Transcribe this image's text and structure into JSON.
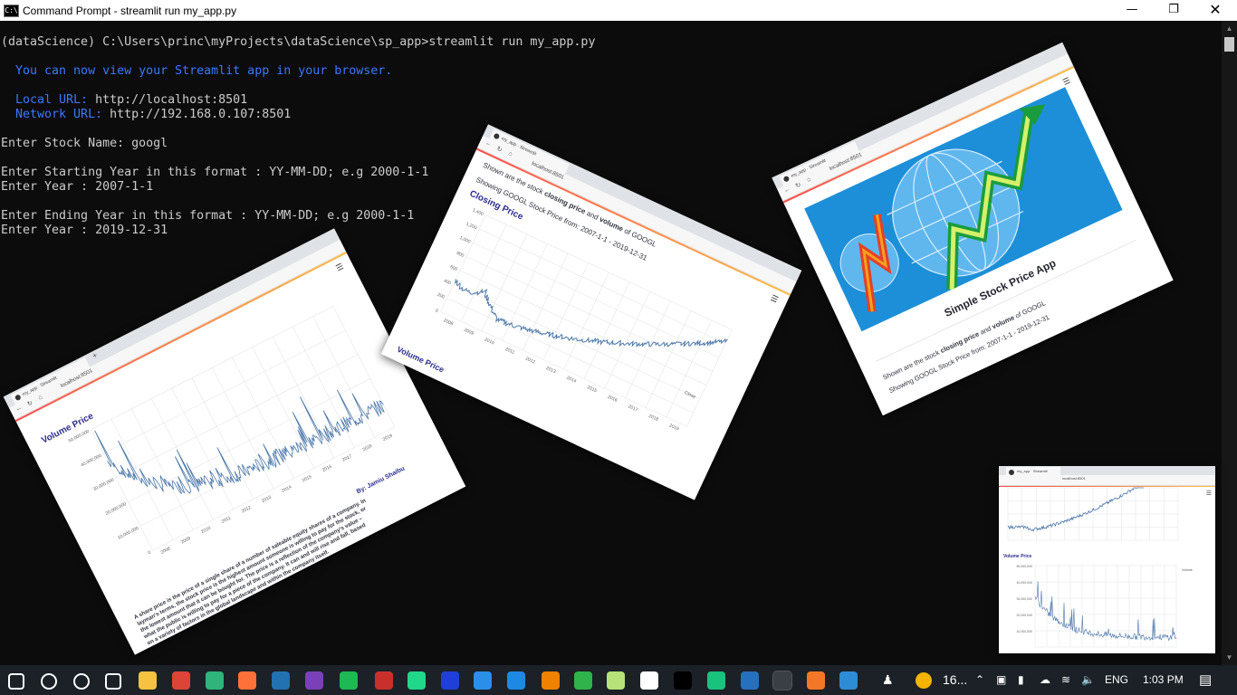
{
  "window": {
    "title": "Command Prompt - streamlit  run my_app.py"
  },
  "console": {
    "lines": [
      {
        "text": "(dataScience) C:\\Users\\princ\\myProjects\\dataScience\\sp_app>streamlit run my_app.py",
        "top": 16
      },
      {
        "text": "  You can now view your Streamlit app in your browser.",
        "top": 48,
        "blue": true
      },
      {
        "label": "  Local URL: ",
        "value": "http://localhost:8501",
        "top": 80
      },
      {
        "label": "  Network URL: ",
        "value": "http://192.168.0.107:8501",
        "top": 96
      },
      {
        "text": "Enter Stock Name: googl",
        "top": 128
      },
      {
        "text": "Enter Starting Year in this format : YY-MM-DD; e.g 2000-1-1",
        "top": 160
      },
      {
        "text": "Enter Year : 2007-1-1",
        "top": 176
      },
      {
        "text": "Enter Ending Year in this format : YY-MM-DD; e.g 2000-1-1",
        "top": 208
      },
      {
        "text": "Enter Year : 2019-12-31",
        "top": 224
      }
    ]
  },
  "shots": {
    "volume": {
      "tab": "my_app · Streamlit",
      "url": "localhost:8501",
      "heading": "Volume Price",
      "legend": "Volume",
      "yticks": [
        "50,000,000",
        "40,000,000",
        "30,000,000",
        "20,000,000",
        "10,000,000",
        "0"
      ],
      "xticks": [
        "2008",
        "2009",
        "2010",
        "2011",
        "2012",
        "2013",
        "2014",
        "2015",
        "2016",
        "2017",
        "2018",
        "2019"
      ],
      "author": "By: Jamiu Shaibu",
      "description_lines": [
        "A share price is the price of a single share of a number of saleable equity shares of a company. In",
        "layman's terms, the stock price is the highest amount someone is willing to pay for the stock, or",
        "the lowest amount that it can be bought for. The price is a reflection of the company's value –",
        "what the public is willing to pay for a piece of the company. It can and will rise and fall, based",
        "on a variety of factors in the global landscape and within the company itself."
      ]
    },
    "closing": {
      "tab": "my_app · Streamlit",
      "url": "localhost:8501",
      "intro_prefix": "Shown are the stock ",
      "intro_b1": "closing price",
      "intro_mid": " and ",
      "intro_b2": "volume",
      "intro_suffix": " of GOOGL",
      "range": "Showing GOOGL Stock Price from: 2007-1-1 - 2019-12-31",
      "heading": "Closing Price",
      "legend": "Close",
      "yticks": [
        "1,400",
        "1,200",
        "1,000",
        "800",
        "600",
        "400",
        "200",
        "0"
      ],
      "xticks": [
        "2008",
        "2009",
        "2010",
        "2011",
        "2012",
        "2013",
        "2014",
        "2015",
        "2016",
        "2017",
        "2018",
        "2019"
      ],
      "next_heading": "Volume Price"
    },
    "app": {
      "tab": "my_app · Streamlit",
      "url": "localhost:8501",
      "app_title": "Simple Stock Price App",
      "intro_prefix": "Shown are the stock ",
      "intro_b1": "closing price",
      "intro_mid": " and ",
      "intro_b2": "volume",
      "intro_suffix": " of GOOGL",
      "range": "Showing GOOGL Stock Price from: 2007-1-1 - 2019-12-31"
    },
    "thumb": {
      "tab": "my_app · Streamlit",
      "url": "localhost:8501",
      "volume_heading": "Volume Price",
      "legend": "Volume",
      "yticks": [
        "50,000,000",
        "40,000,000",
        "30,000,000",
        "20,000,000",
        "10,000,000"
      ]
    }
  },
  "taskbar": {
    "apps": [
      "start",
      "search",
      "cortana",
      "task-view",
      "file-explorer",
      "chrome",
      "edge",
      "firefox",
      "wordpress",
      "github-desktop",
      "spotify",
      "settings",
      "pycharm",
      "malwarebytes",
      "vscode",
      "messenger",
      "vlc",
      "refresh-app",
      "notepad",
      "steam",
      "intellij",
      "chatgpt",
      "powershell",
      "command-prompt",
      "jupyter",
      "photos"
    ],
    "weather": "16...",
    "lang": "ENG",
    "time": "1:03 PM"
  }
}
